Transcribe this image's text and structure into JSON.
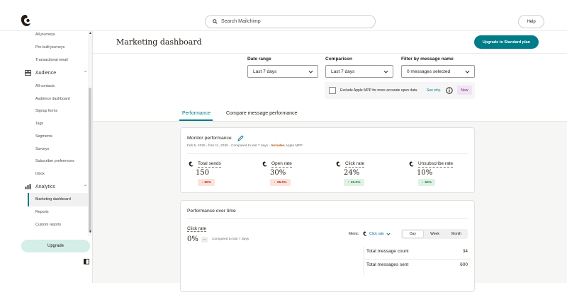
{
  "topbar": {
    "search_placeholder": "Search Mailchimp",
    "help_label": "Help"
  },
  "sidebar": {
    "items": [
      {
        "label": "All journeys"
      },
      {
        "label": "Pre-built journeys"
      },
      {
        "label": "Transactional email"
      },
      {
        "label": "All contacts"
      },
      {
        "label": "Audience dashboard"
      },
      {
        "label": "Signup forms"
      },
      {
        "label": "Tags"
      },
      {
        "label": "Segments"
      },
      {
        "label": "Surveys"
      },
      {
        "label": "Subscriber preferences"
      },
      {
        "label": "Inbox"
      },
      {
        "label": "Reports"
      },
      {
        "label": "Custom reports"
      }
    ],
    "groups": {
      "audience": "Audience",
      "analytics": "Analytics"
    },
    "active_item": "Marketing dashboard",
    "upgrade_label": "Upgrade"
  },
  "header": {
    "title": "Marketing dashboard",
    "upgrade_button": "Upgrade to Standard plan"
  },
  "filters": {
    "date_range": {
      "label": "Date range",
      "value": "Last 7 days"
    },
    "comparison": {
      "label": "Comparison",
      "value": "Last 7 days"
    },
    "message_name": {
      "label": "Filter by message name",
      "value": "0 messages selected"
    },
    "mpp_text": "Exclude Apple MPP for more accurate open data.",
    "mpp_link": "See why.",
    "new_badge": "New"
  },
  "tabs": [
    {
      "label": "Performance",
      "active": true
    },
    {
      "label": "Compare message performance",
      "active": false
    }
  ],
  "monitor": {
    "title": "Monitor performance",
    "subtitle_prefix": "Feb 5, 2025 - Feb 11, 2025 · Compared to last 7 days ·",
    "subtitle_flag": "Includes",
    "subtitle_suffix": "Apple MPP",
    "metrics": [
      {
        "label": "Total sends",
        "value": "150",
        "change": "50%",
        "direction": "down"
      },
      {
        "label": "Open rate",
        "value": "30%",
        "change": "25.0%",
        "direction": "down"
      },
      {
        "label": "Click rate",
        "value": "24%",
        "change": "20.0%",
        "direction": "up"
      },
      {
        "label": "Unsubscribe rate",
        "value": "10%",
        "change": "50%",
        "direction": "down"
      }
    ]
  },
  "over_time": {
    "title": "Performance over time",
    "metric_label": "Click rate",
    "metric_value": "0%",
    "metric_change": "--",
    "compared_text": "Compared to last 7 days",
    "metric_select_label": "Metric:",
    "metric_select_value": "Click rate",
    "periods": [
      "Day",
      "Week",
      "Month"
    ],
    "active_period": "Day",
    "totals": [
      {
        "label": "Total message count",
        "value": "34"
      },
      {
        "label": "Total messages sent",
        "value": "600"
      }
    ]
  },
  "colors": {
    "accent": "#007c89",
    "upgrade_soft": "#d4eee8",
    "down": "#b3261e",
    "up": "#1f7a3a",
    "new_badge": "#f0e3f4"
  }
}
